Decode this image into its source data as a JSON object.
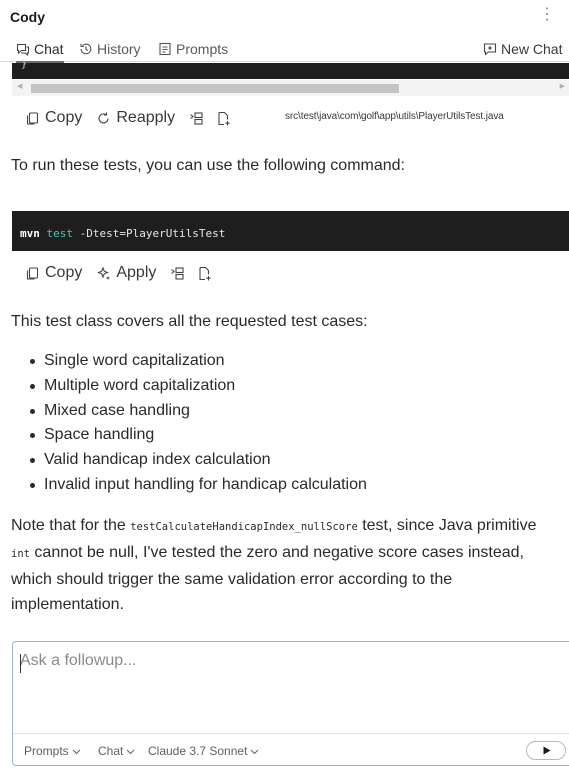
{
  "app": {
    "title": "Cody",
    "more_icon": "kebab-menu-icon"
  },
  "tabs": [
    {
      "label": "Chat",
      "icon": "chat-icon",
      "active": true
    },
    {
      "label": "History",
      "icon": "history-icon",
      "active": false
    },
    {
      "label": "Prompts",
      "icon": "prompts-icon",
      "active": false
    }
  ],
  "new_chat_label": "New Chat",
  "code_block_1": {
    "visible_fragment": "}"
  },
  "actions_1": {
    "copy_label": "Copy",
    "reapply_label": "Reapply",
    "file_path": "src\\test\\java\\com\\golf\\app\\utils\\PlayerUtilsTest.java"
  },
  "message": {
    "intro": "To run these tests, you can use the following command:",
    "command": {
      "cmd": "mvn",
      "kw": "test",
      "args": " -Dtest=PlayerUtilsTest"
    },
    "coverage_intro": "This test class covers all the requested test cases:",
    "bullets": [
      "Single word capitalization",
      "Multiple word capitalization",
      "Mixed case handling",
      "Space handling",
      "Valid handicap index calculation",
      "Invalid input handling for handicap calculation"
    ],
    "note_part1": "Note that for the ",
    "note_code1": "testCalculateHandicapIndex_nullScore",
    "note_part2": " test, since Java primitive ",
    "note_code2": "int",
    "note_part3": " cannot be null, I've tested the zero and negative score cases instead, which should trigger the same validation error according to the implementation."
  },
  "actions_2": {
    "copy_label": "Copy",
    "apply_label": "Apply"
  },
  "input": {
    "placeholder": "Ask a followup...",
    "value": "",
    "prompts_label": "Prompts",
    "mode_label": "Chat",
    "model_label": "Claude 3.7 Sonnet"
  }
}
